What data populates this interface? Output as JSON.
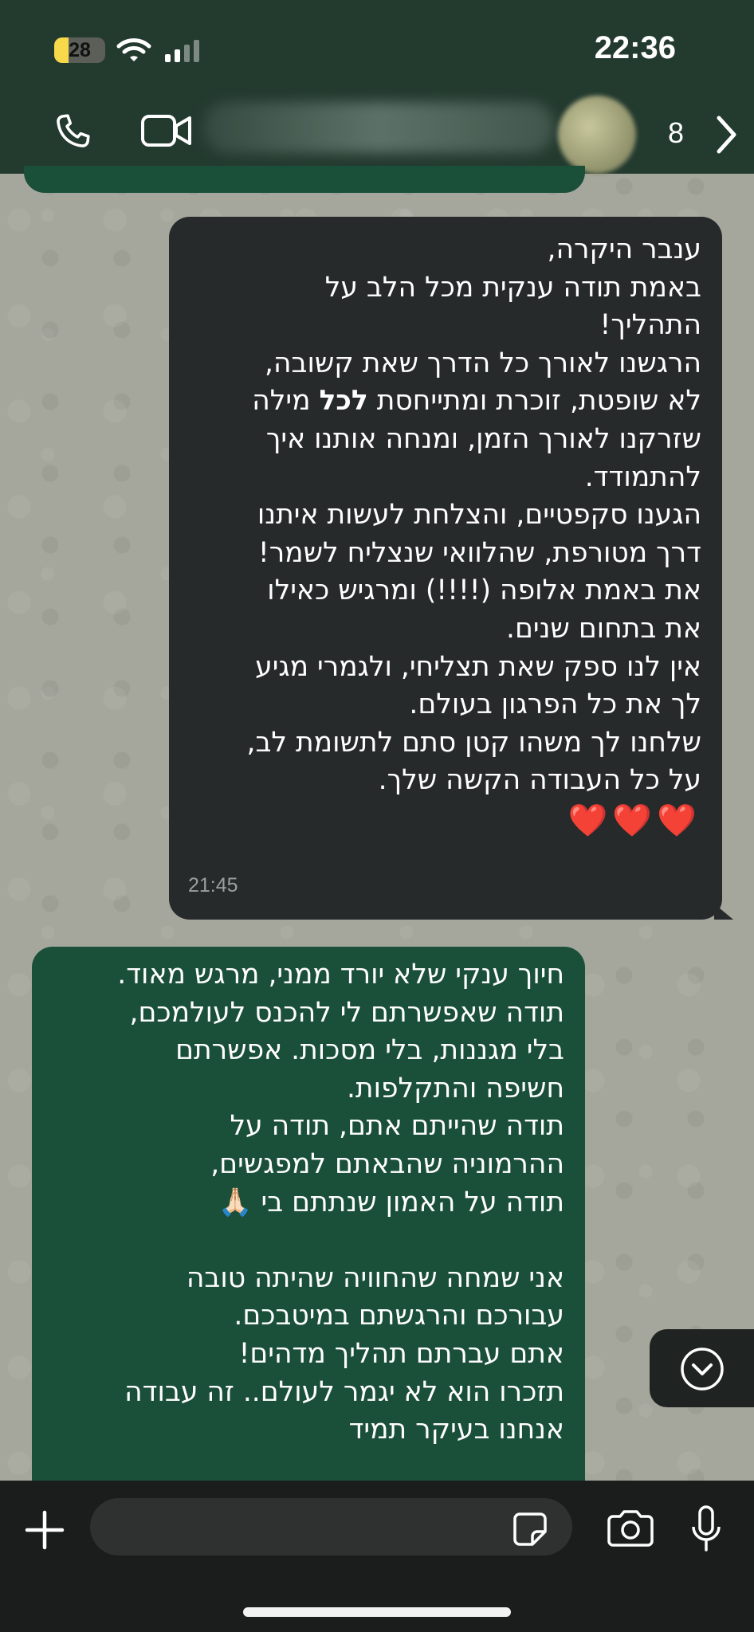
{
  "status_bar": {
    "time": "22:36",
    "battery_level": "28",
    "battery_fraction": 0.28,
    "battery_color": "#f7d94a"
  },
  "header": {
    "unread_count": "8",
    "icons": [
      "call-icon",
      "video-icon",
      "chevron-right-icon"
    ]
  },
  "messages": [
    {
      "direction": "outgoing",
      "time": "21:45",
      "lines": [
        "ענבר היקרה,",
        "באמת תודה ענקית מכל הלב על",
        "התהליך!",
        "הרגשנו לאורך כל הדרך שאת קשובה,",
        {
          "pre": "לא שופטת, זוכרת ומתייחסת ",
          "bold": "לכל",
          "post": " מילה"
        },
        "שזרקנו לאורך הזמן, ומנחה אותנו איך",
        "להתמודד.",
        "הגענו סקפטיים, והצלחת לעשות איתנו",
        "דרך מטורפת, שהלוואי שנצליח לשמר!",
        "את באמת אלופה (!!!!) ומרגיש כאילו",
        "את בתחום שנים.",
        "אין לנו ספק שאת תצליחי, ולגמרי מגיע",
        "לך את כל הפרגון בעולם.",
        "שלחנו לך משהו קטן סתם לתשומת לב,",
        "על כל העבודה הקשה שלך."
      ],
      "emoji": "❤️❤️❤️"
    },
    {
      "direction": "incoming",
      "lines": [
        "חיוך ענקי שלא יורד ממני, מרגש מאוד.",
        "תודה שאפשרתם לי להכנס לעולמכם,",
        "בלי מגננות, בלי מסכות. אפשרתם",
        "חשיפה והתקלפות.",
        "תודה שהייתם אתם, תודה על",
        "ההרמוניה שהבאתם למפגשים,",
        "תודה על האמון שנתתם בי 🙏🏻",
        "",
        "אני שמחה שהחוויה שהיתה טובה",
        "עבורכם והרגשתם במיטבכם.",
        "אתם עברתם תהליך מדהים!",
        "תזכרו הוא לא יגמר לעולם.. זה עבודה",
        "אנחנו בעיקר תמיד"
      ]
    }
  ],
  "input": {
    "placeholder": "",
    "value": ""
  },
  "colors": {
    "header_bg": "#233a2f",
    "outgoing_bubble": "#272a2b",
    "incoming_bubble": "#1a4f3a",
    "input_bar": "#1b1d1c"
  }
}
